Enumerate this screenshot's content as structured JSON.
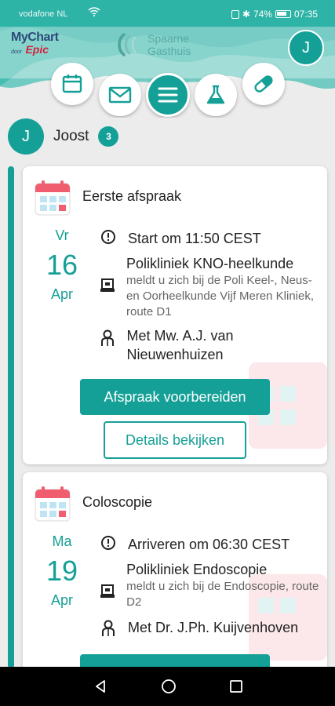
{
  "status_bar": {
    "carrier": "vodafone NL",
    "battery": "74%",
    "time": "07:35"
  },
  "header": {
    "brand_line1": "MyChart",
    "brand_door": "door",
    "brand_epic": "Epic",
    "hospital_line1": "Spaarne",
    "hospital_line2": "Gasthuis",
    "avatar_initial": "J",
    "nav": [
      "calendar-icon",
      "mail-icon",
      "menu-icon",
      "flask-icon",
      "pill-icon"
    ]
  },
  "user": {
    "initial": "J",
    "name": "Joost",
    "badge": "3"
  },
  "appointments": [
    {
      "title": "Eerste afspraak",
      "dow": "Vr",
      "day": "16",
      "month": "Apr",
      "time_text": "Start om 11:50 CEST",
      "location": "Polikliniek KNO-heelkunde",
      "location_note": "meldt u zich bij de Poli Keel-, Neus- en Oorheelkunde Vijf Meren Kliniek, route D1",
      "provider": "Met Mw. A.J. van Nieuwenhuizen",
      "primary_button": "Afspraak voorbereiden",
      "secondary_button": "Details bekijken"
    },
    {
      "title": "Coloscopie",
      "dow": "Ma",
      "day": "19",
      "month": "Apr",
      "time_text": "Arriveren om 06:30 CEST",
      "location": "Polikliniek Endoscopie",
      "location_note": "meldt u zich bij de Endoscopie, route D2",
      "provider": "Met Dr. J.Ph. Kuijvenhoven"
    }
  ],
  "colors": {
    "accent": "#15a097",
    "header_bg": "#2eb3a7",
    "background": "#ececec"
  }
}
